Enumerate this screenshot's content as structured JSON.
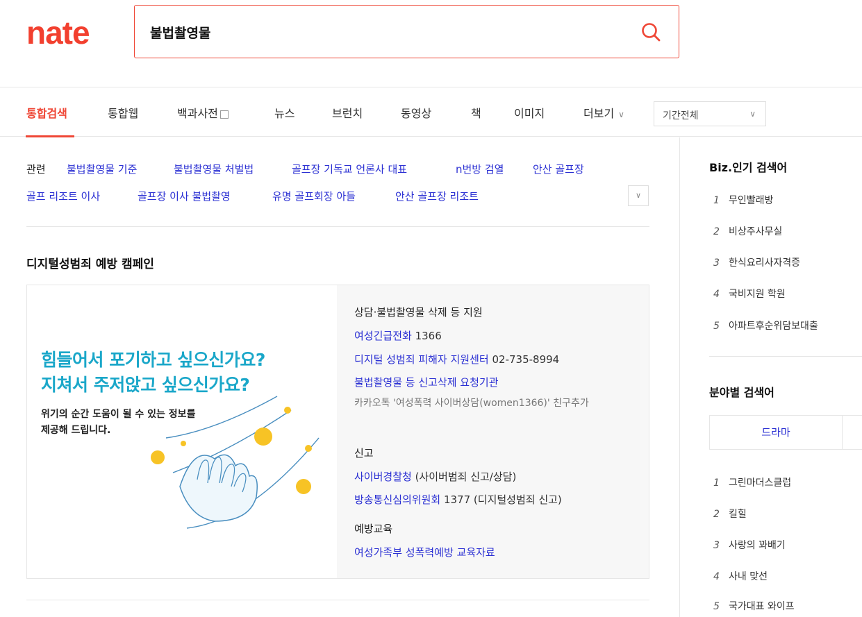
{
  "logo": "nate",
  "search": {
    "query": "불법촬영물"
  },
  "tabs": {
    "integrated": "통합검색",
    "web": "통합웹",
    "encyclopedia": "백과사전",
    "news": "뉴스",
    "brunch": "브런치",
    "video": "동영상",
    "book": "책",
    "image": "이미지",
    "more": "더보기",
    "period": "기간전체"
  },
  "related": {
    "label": "관련",
    "links": [
      "불법촬영물 기준",
      "불법촬영물 처벌법",
      "골프장 기독교 언론사 대표",
      "n번방 검열",
      "안산 골프장",
      "골프 리조트 이사",
      "골프장 이사 불법촬영",
      "유명 골프회장 아들",
      "안산 골프장 리조트"
    ]
  },
  "campaign": {
    "title": "디지털성범죄 예방 캠페인",
    "headline1": "힘들어서 포기하고 싶으신가요?",
    "headline2": "지쳐서 주저앉고 싶으신가요?",
    "sub1": "위기의 순간 도움이 될 수 있는 정보를",
    "sub2": "제공해 드립니다.",
    "support_head": "상담·불법촬영물 삭제 등 지원",
    "hotline_link": "여성긴급전화",
    "hotline_num": " 1366",
    "center_link": "디지털 성범죄 피해자 지원센터",
    "center_num": " 02-735-8994",
    "report_org_link": "불법촬영물 등 신고삭제 요청기관",
    "kakao": "카카오톡 '여성폭력 사이버상담(women1366)' 친구추가",
    "report_head": "신고",
    "police_link": "사이버경찰청",
    "police_desc": " (사이버범죄 신고/상담)",
    "kocsc_link": "방송통신심의위원회",
    "kocsc_desc": " 1377 (디지털성범죄 신고)",
    "edu_head": "예방교육",
    "edu_link": "여성가족부 성폭력예방 교육자료"
  },
  "sidebar": {
    "biz_title": "Biz.인기 검색어",
    "biz_items": [
      {
        "num": "1",
        "text": "무인빨래방"
      },
      {
        "num": "2",
        "text": "비상주사무실"
      },
      {
        "num": "3",
        "text": "한식요리사자격증"
      },
      {
        "num": "4",
        "text": "국비지원 학원"
      },
      {
        "num": "5",
        "text": "아파트후순위담보대출"
      }
    ],
    "field_title": "분야별 검색어",
    "field_tab": "드라마",
    "field_items": [
      {
        "num": "1",
        "text": "그린마더스클럽"
      },
      {
        "num": "2",
        "text": "킬힐"
      },
      {
        "num": "3",
        "text": "사랑의 꽈배기"
      },
      {
        "num": "4",
        "text": "사내 맞선"
      },
      {
        "num": "5",
        "text": "국가대표 와이프"
      }
    ]
  },
  "colors": {
    "brand": "#ef4736",
    "link": "#2a2fd3",
    "headline": "#1aa7c9"
  }
}
